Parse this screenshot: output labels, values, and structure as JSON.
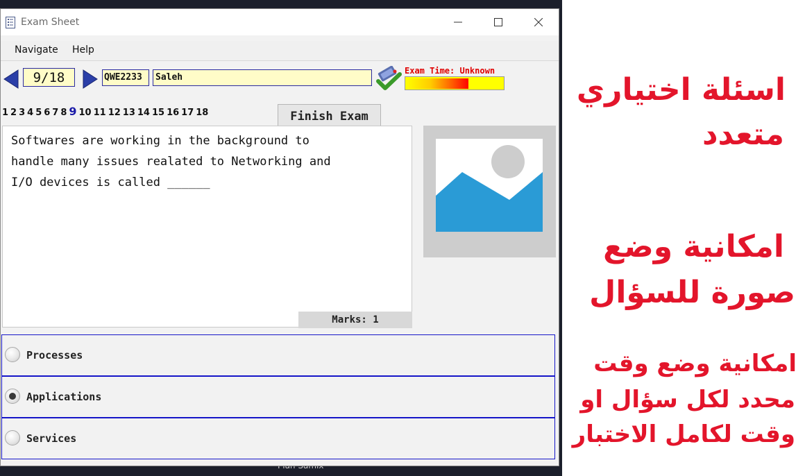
{
  "window": {
    "title": "Exam Sheet",
    "icon": "checklist-icon"
  },
  "menu": {
    "navigate": "Navigate",
    "help": "Help"
  },
  "toolbar": {
    "page_counter": "9/18",
    "student_id": "QWE2233",
    "student_name": "Saleh",
    "exam_time_label": "Exam Time: Unknown",
    "time_progress": 0.64,
    "finish_button": "Finish Exam"
  },
  "question_nav": {
    "numbers": [
      "1",
      "2",
      "3",
      "4",
      "5",
      "6",
      "7",
      "8",
      "9",
      "10",
      "11",
      "12",
      "13",
      "14",
      "15",
      "16",
      "17",
      "18"
    ],
    "current": "9"
  },
  "question": {
    "text": "Softwares are working in the background to\nhandle many issues realated to Networking and\nI/O devices is called ______",
    "marks": "Marks: 1"
  },
  "answers": [
    {
      "label": "Processes",
      "selected": false
    },
    {
      "label": "Applications",
      "selected": true
    },
    {
      "label": "Services",
      "selected": false
    }
  ],
  "side_notes": {
    "line1a": "اسئلة اختياري",
    "line1b": "متعدد",
    "line2a": "امكانية وضع",
    "line2b": "صورة للسؤال",
    "line3a": "امكانية وضع وقت",
    "line3b": "محدد لكل سؤال او",
    "line3c": "وقت لكامل الاختبار"
  },
  "desktop": {
    "caption": "Plan Samix"
  },
  "colors": {
    "accent_border": "#1515c8",
    "note_red": "#e3152b",
    "field_bg": "#fffcc8",
    "time_label": "#e00000"
  }
}
